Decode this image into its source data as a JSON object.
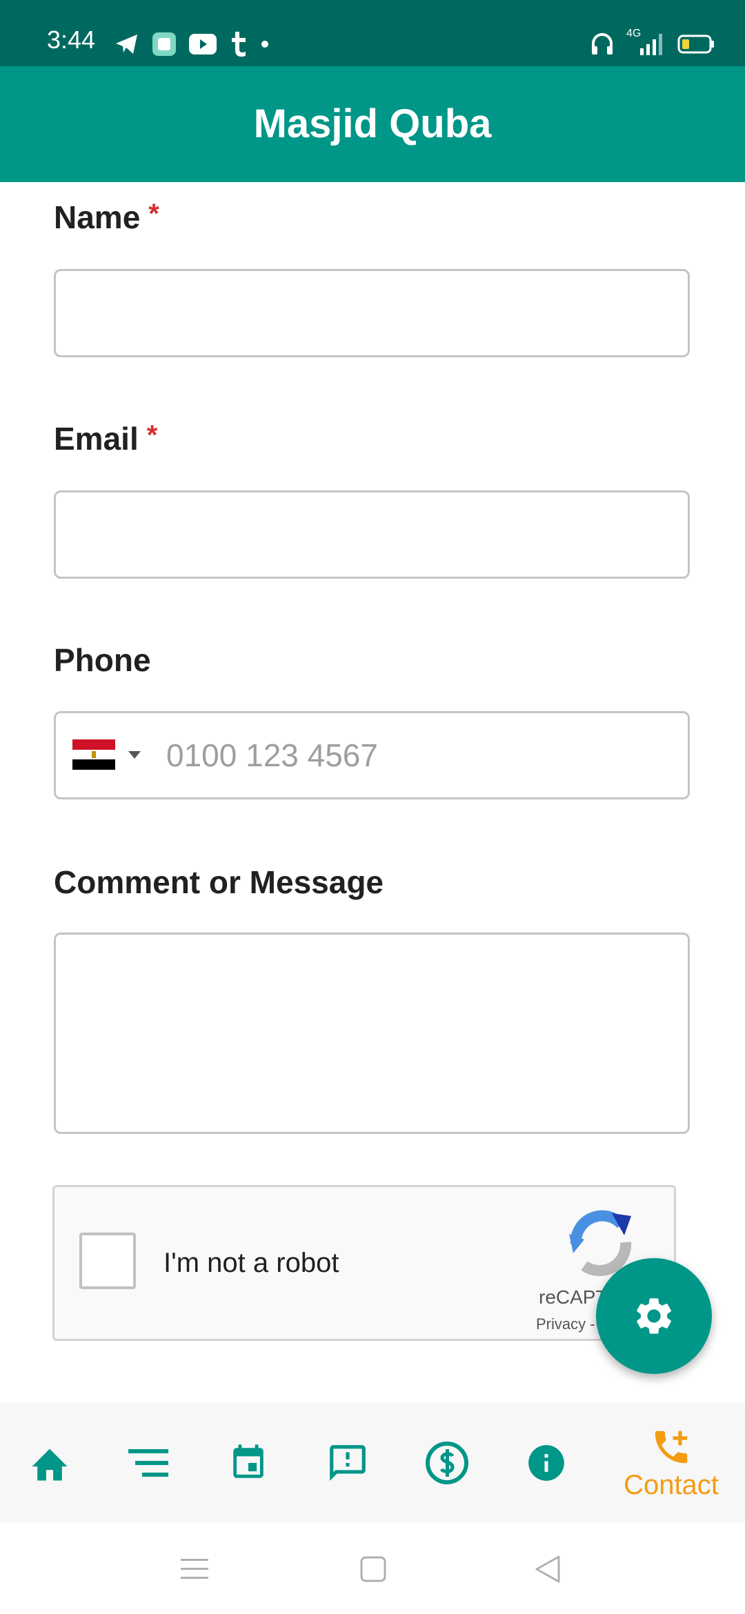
{
  "status_bar": {
    "time": "3:44",
    "network_label": "4G",
    "left_icons": [
      "telegram-icon",
      "app-icon",
      "youtube-icon",
      "tumblr-icon",
      "dot-icon"
    ],
    "right_icons": [
      "headset-icon",
      "signal-icon",
      "battery-icon"
    ]
  },
  "app_bar": {
    "title": "Masjid Quba"
  },
  "form": {
    "name_label": "Name",
    "email_label": "Email",
    "phone_label": "Phone",
    "phone_placeholder": "0100 123 4567",
    "message_label": "Comment or Message",
    "required_marker": "*"
  },
  "recaptcha": {
    "label": "I'm not a robot",
    "brand": "reCAPT",
    "links": "Privacy -"
  },
  "bottom_nav": {
    "items": [
      {
        "icon": "home-icon"
      },
      {
        "icon": "list-icon"
      },
      {
        "icon": "calendar-icon"
      },
      {
        "icon": "feedback-icon"
      },
      {
        "icon": "donate-icon"
      },
      {
        "icon": "info-icon"
      },
      {
        "icon": "add-call-icon",
        "label": "Contact"
      }
    ]
  },
  "colors": {
    "primary": "#009688",
    "primary_dark": "#00695f",
    "active": "#f39c12",
    "required": "#d32f2f"
  }
}
